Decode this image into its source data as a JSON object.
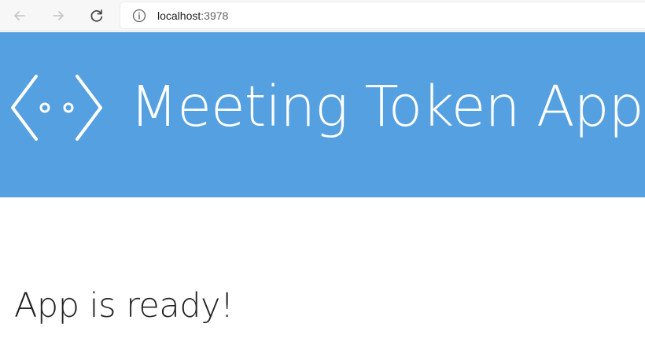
{
  "browser": {
    "url_host": "localhost",
    "url_port": ":3978",
    "icons": {
      "back": "arrow-left-icon",
      "forward": "arrow-right-icon",
      "reload": "reload-icon",
      "info": "info-icon"
    }
  },
  "header": {
    "title": "Meeting Token App",
    "logo": "bot-face-icon",
    "background_color": "#54a0e0"
  },
  "main": {
    "status": "App is ready!"
  }
}
